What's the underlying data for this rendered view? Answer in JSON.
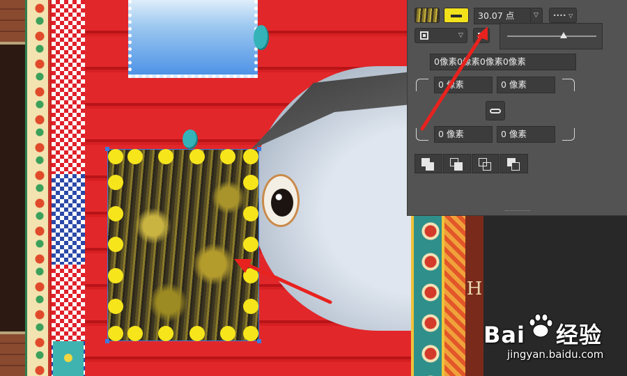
{
  "panel": {
    "stroke_width_value": "30.07 点",
    "padding_combined": "0像素0像素0像素0像素",
    "corner_top_left": "0 像素",
    "corner_top_right": "0 像素",
    "corner_bottom_left": "0 像素",
    "corner_bottom_right": "0 像素",
    "dash_style_label": "••••",
    "fill_swatch_icon": "pattern-forest-swatch",
    "stroke_swatch_color": "#f2e21c"
  },
  "watermark": {
    "brand_text": "Bai",
    "brand_text_suffix": "经验",
    "url_text": "jingyan.baidu.com"
  },
  "canvas": {
    "sign_letter": "H",
    "dot_color": "#f7e51c",
    "arrow_color": "#e8221e"
  }
}
